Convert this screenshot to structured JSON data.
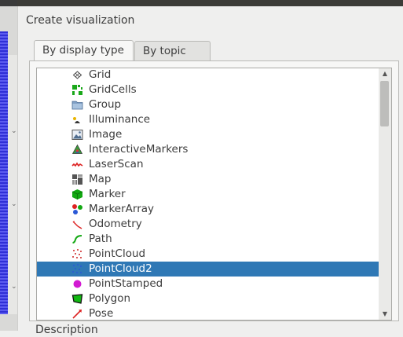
{
  "dialog": {
    "title": "Create visualization",
    "tabs": [
      {
        "label": "By display type",
        "active": true
      },
      {
        "label": "By topic",
        "active": false
      }
    ],
    "description_label": "Description"
  },
  "list": {
    "selected_index": 12,
    "items": [
      {
        "label": "Grid",
        "icon": "grid-icon"
      },
      {
        "label": "GridCells",
        "icon": "grid-cells-icon"
      },
      {
        "label": "Group",
        "icon": "folder-icon"
      },
      {
        "label": "Illuminance",
        "icon": "illuminance-icon"
      },
      {
        "label": "Image",
        "icon": "image-icon"
      },
      {
        "label": "InteractiveMarkers",
        "icon": "interactive-markers-icon"
      },
      {
        "label": "LaserScan",
        "icon": "laser-scan-icon"
      },
      {
        "label": "Map",
        "icon": "map-icon"
      },
      {
        "label": "Marker",
        "icon": "marker-cube-icon"
      },
      {
        "label": "MarkerArray",
        "icon": "marker-array-icon"
      },
      {
        "label": "Odometry",
        "icon": "odometry-icon"
      },
      {
        "label": "Path",
        "icon": "path-icon"
      },
      {
        "label": "PointCloud",
        "icon": "point-cloud-icon"
      },
      {
        "label": "PointCloud2",
        "icon": "point-cloud2-icon"
      },
      {
        "label": "PointStamped",
        "icon": "point-stamped-icon"
      },
      {
        "label": "Polygon",
        "icon": "polygon-icon"
      },
      {
        "label": "Pose",
        "icon": "pose-icon"
      }
    ]
  },
  "colors": {
    "selection": "#2f78b5",
    "dialog_bg": "#efefee",
    "list_bg": "#ffffff"
  }
}
